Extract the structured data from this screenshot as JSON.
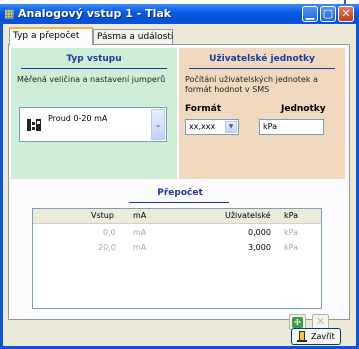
{
  "window": {
    "title": "Analogový vstup 1 - Tlak",
    "buttons": [
      "minimize",
      "maximize",
      "close"
    ]
  },
  "tabs": [
    {
      "label": "Typ a přepočet",
      "active": true
    },
    {
      "label": "Pásma a události",
      "active": false
    }
  ],
  "input_type": {
    "title": "Typ vstupu",
    "description": "Měřená veličina a nastavení jumperů",
    "selected": "Proud 0-20 mA",
    "icon": "jumper-icon"
  },
  "user_units": {
    "title": "Uživatelské jednotky",
    "description": "Počítání uživatelských jednotek a formát hodnot v SMS",
    "format_label": "Formát",
    "format_value": "xx,xxx",
    "units_label": "Jednotky",
    "units_value": "kPa"
  },
  "conversion": {
    "title": "Přepočet",
    "headers": {
      "input": "Vstup",
      "input_unit": "mA",
      "user": "Uživatelské",
      "user_unit": "kPa"
    },
    "rows": [
      {
        "input": "0,0",
        "input_unit": "mA",
        "user": "0,000",
        "user_unit": "kPa"
      },
      {
        "input": "20,0",
        "input_unit": "mA",
        "user": "3,000",
        "user_unit": "kPa"
      }
    ]
  },
  "actions": {
    "add": "+",
    "remove": "✕",
    "close": "Zavřít"
  },
  "colors": {
    "title_bar": "#0a55d8",
    "green_panel": "#cfeed8",
    "orange_panel": "#f1d9bf",
    "accent_text": "#1f3a9e"
  }
}
